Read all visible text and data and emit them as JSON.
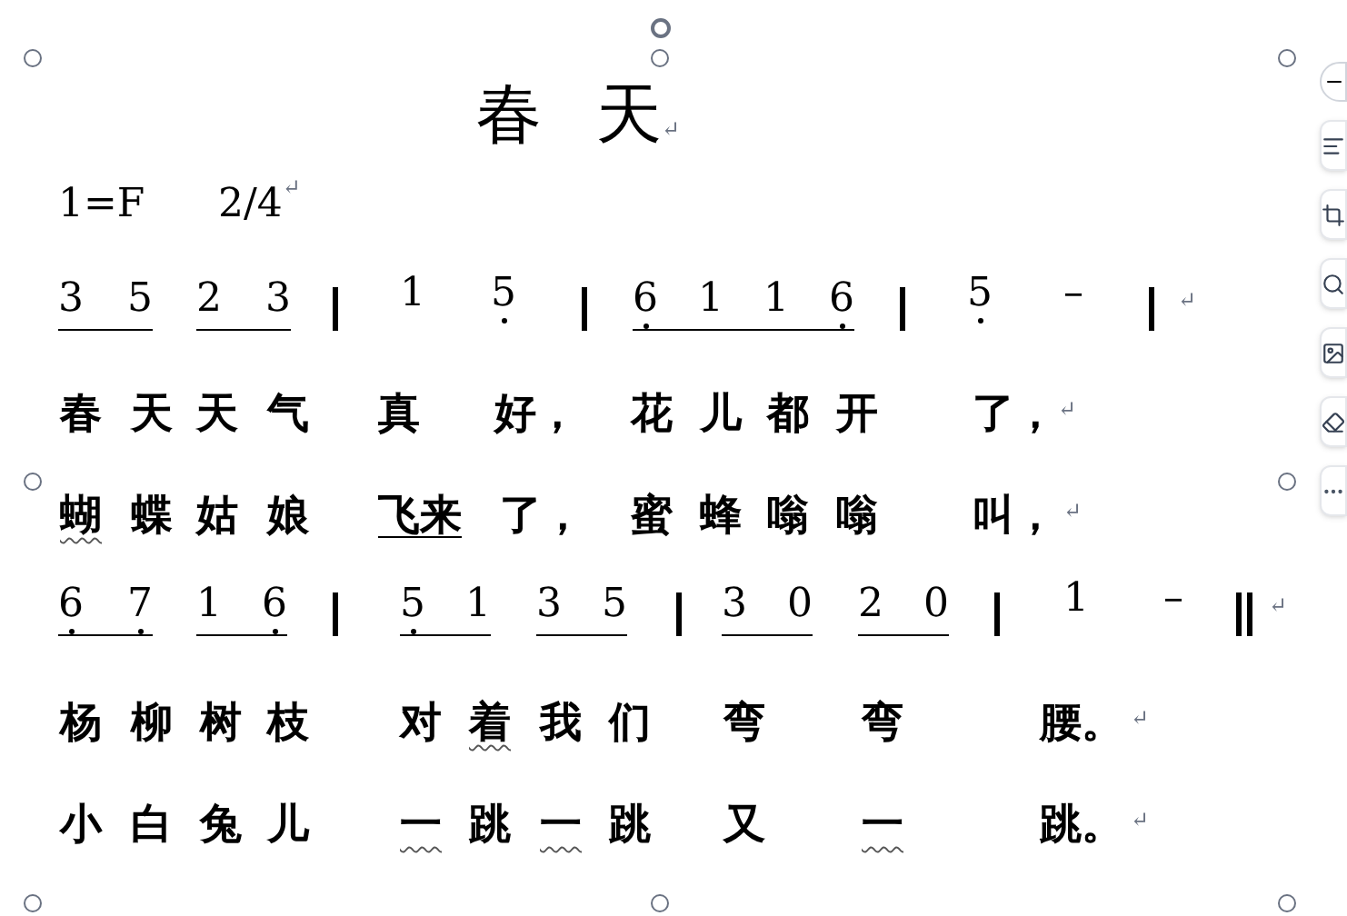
{
  "title": {
    "chars": [
      "春",
      "天"
    ],
    "end_mark": "↵"
  },
  "key_signature": {
    "key": "1=F",
    "time": "2/4",
    "end_mark": "↵"
  },
  "lines": [
    {
      "kind": "notation",
      "end_mark": "↵",
      "items": [
        {
          "kind": "group",
          "notes": [
            {
              "text": "3",
              "dot_below": false
            },
            {
              "text": "5",
              "dot_below": false
            }
          ]
        },
        {
          "kind": "group",
          "notes": [
            {
              "text": "2",
              "dot_below": false
            },
            {
              "text": "3",
              "dot_below": false
            }
          ]
        },
        {
          "kind": "bar"
        },
        {
          "kind": "note",
          "notes": [
            {
              "text": "1",
              "dot_below": false
            }
          ]
        },
        {
          "kind": "note",
          "notes": [
            {
              "text": "5",
              "dot_below": true
            }
          ]
        },
        {
          "kind": "bar"
        },
        {
          "kind": "group",
          "notes": [
            {
              "text": "6",
              "dot_below": true
            },
            {
              "text": "1",
              "dot_below": false
            },
            {
              "text": "1",
              "dot_below": false
            },
            {
              "text": "6",
              "dot_below": true
            }
          ]
        },
        {
          "kind": "bar"
        },
        {
          "kind": "note",
          "notes": [
            {
              "text": "5",
              "dot_below": true
            }
          ]
        },
        {
          "kind": "note",
          "notes": [
            {
              "text": "–",
              "dot_below": false
            }
          ]
        },
        {
          "kind": "bar"
        }
      ]
    },
    {
      "kind": "lyrics",
      "end_mark": "↵",
      "syllables": [
        {
          "text": "春",
          "underline": false,
          "wavy": false
        },
        {
          "text": "天",
          "underline": false,
          "wavy": false
        },
        {
          "text": "天",
          "underline": false,
          "wavy": false
        },
        {
          "text": "气",
          "underline": false,
          "wavy": false
        },
        {
          "text": "真",
          "underline": false,
          "wavy": false
        },
        {
          "text": "好，",
          "underline": false,
          "wavy": false
        },
        {
          "text": "花",
          "underline": false,
          "wavy": false
        },
        {
          "text": "儿",
          "underline": false,
          "wavy": false
        },
        {
          "text": "都",
          "underline": false,
          "wavy": false
        },
        {
          "text": "开",
          "underline": false,
          "wavy": false
        },
        {
          "text": "了，",
          "underline": false,
          "wavy": false
        }
      ]
    },
    {
      "kind": "lyrics",
      "end_mark": "↵",
      "syllables": [
        {
          "text": "蝴",
          "underline": false,
          "wavy": true
        },
        {
          "text": "蝶",
          "underline": false,
          "wavy": false
        },
        {
          "text": "姑",
          "underline": false,
          "wavy": false
        },
        {
          "text": "娘",
          "underline": false,
          "wavy": false
        },
        {
          "text": "飞来",
          "underline": true,
          "wavy": false
        },
        {
          "text": "了，",
          "underline": false,
          "wavy": false
        },
        {
          "text": "蜜",
          "underline": false,
          "wavy": false
        },
        {
          "text": "蜂",
          "underline": false,
          "wavy": false
        },
        {
          "text": "嗡",
          "underline": false,
          "wavy": false
        },
        {
          "text": "嗡",
          "underline": false,
          "wavy": false
        },
        {
          "text": "叫，",
          "underline": false,
          "wavy": false
        }
      ]
    },
    {
      "kind": "notation",
      "end_mark": "↵",
      "items": [
        {
          "kind": "group",
          "notes": [
            {
              "text": "6",
              "dot_below": true
            },
            {
              "text": "7",
              "dot_below": true
            }
          ]
        },
        {
          "kind": "group",
          "notes": [
            {
              "text": "1",
              "dot_below": false
            },
            {
              "text": "6",
              "dot_below": true
            }
          ]
        },
        {
          "kind": "bar"
        },
        {
          "kind": "group",
          "notes": [
            {
              "text": "5",
              "dot_below": true
            },
            {
              "text": "1",
              "dot_below": false
            }
          ]
        },
        {
          "kind": "group",
          "notes": [
            {
              "text": "3",
              "dot_below": false
            },
            {
              "text": "5",
              "dot_below": false
            }
          ]
        },
        {
          "kind": "bar"
        },
        {
          "kind": "group",
          "notes": [
            {
              "text": "3",
              "dot_below": false
            },
            {
              "text": "0",
              "dot_below": false
            }
          ]
        },
        {
          "kind": "group",
          "notes": [
            {
              "text": "2",
              "dot_below": false
            },
            {
              "text": "0",
              "dot_below": false
            }
          ]
        },
        {
          "kind": "bar"
        },
        {
          "kind": "note",
          "notes": [
            {
              "text": "1",
              "dot_below": false
            }
          ]
        },
        {
          "kind": "note",
          "notes": [
            {
              "text": "–",
              "dot_below": false
            }
          ]
        },
        {
          "kind": "final_bar"
        }
      ]
    },
    {
      "kind": "lyrics",
      "end_mark": "↵",
      "syllables": [
        {
          "text": "杨",
          "underline": false,
          "wavy": false
        },
        {
          "text": "柳",
          "underline": false,
          "wavy": false
        },
        {
          "text": "树",
          "underline": false,
          "wavy": false
        },
        {
          "text": "枝",
          "underline": false,
          "wavy": false
        },
        {
          "text": "对",
          "underline": false,
          "wavy": false
        },
        {
          "text": "着",
          "underline": false,
          "wavy": true
        },
        {
          "text": "我",
          "underline": false,
          "wavy": false
        },
        {
          "text": "们",
          "underline": false,
          "wavy": false
        },
        {
          "text": "弯",
          "underline": false,
          "wavy": false
        },
        {
          "text": "弯",
          "underline": false,
          "wavy": false
        },
        {
          "text": "腰。",
          "underline": false,
          "wavy": false
        }
      ]
    },
    {
      "kind": "lyrics",
      "end_mark": "↵",
      "syllables": [
        {
          "text": "小",
          "underline": false,
          "wavy": false
        },
        {
          "text": "白",
          "underline": false,
          "wavy": false
        },
        {
          "text": "兔",
          "underline": false,
          "wavy": false
        },
        {
          "text": "儿",
          "underline": false,
          "wavy": false
        },
        {
          "text": "一",
          "underline": false,
          "wavy": true
        },
        {
          "text": "跳",
          "underline": false,
          "wavy": false
        },
        {
          "text": "一",
          "underline": false,
          "wavy": true
        },
        {
          "text": "跳",
          "underline": false,
          "wavy": false
        },
        {
          "text": "又",
          "underline": false,
          "wavy": false
        },
        {
          "text": "一",
          "underline": false,
          "wavy": true
        },
        {
          "text": "跳。",
          "underline": false,
          "wavy": false
        }
      ]
    }
  ]
}
